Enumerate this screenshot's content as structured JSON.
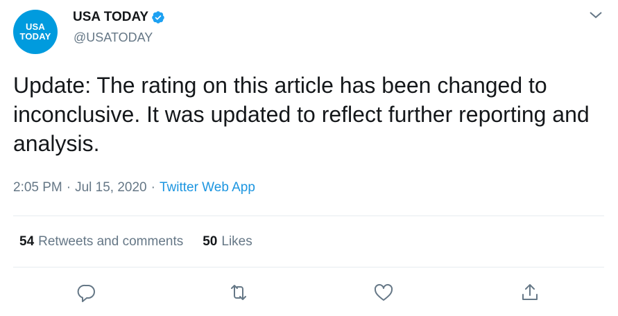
{
  "account": {
    "avatar_line1": "USA",
    "avatar_line2": "TODAY",
    "display_name": "USA TODAY",
    "handle": "@USATODAY",
    "verified_icon": "verified-badge-icon",
    "brand_color": "#009bde"
  },
  "tweet": {
    "text": "Update: The rating on this article has been changed to inconclusive. It was updated to reflect further reporting and analysis.",
    "time": "2:05 PM",
    "date": "Jul 15, 2020",
    "separator": "·",
    "source": "Twitter Web App"
  },
  "stats": {
    "retweets_count": "54",
    "retweets_label": "Retweets and comments",
    "likes_count": "50",
    "likes_label": "Likes"
  },
  "actions": {
    "reply_icon": "reply-icon",
    "retweet_icon": "retweet-icon",
    "like_icon": "like-icon",
    "share_icon": "share-icon"
  },
  "colors": {
    "text": "#14171a",
    "secondary": "#657786",
    "link": "#1b95e0",
    "divider": "#e6ecf0"
  }
}
